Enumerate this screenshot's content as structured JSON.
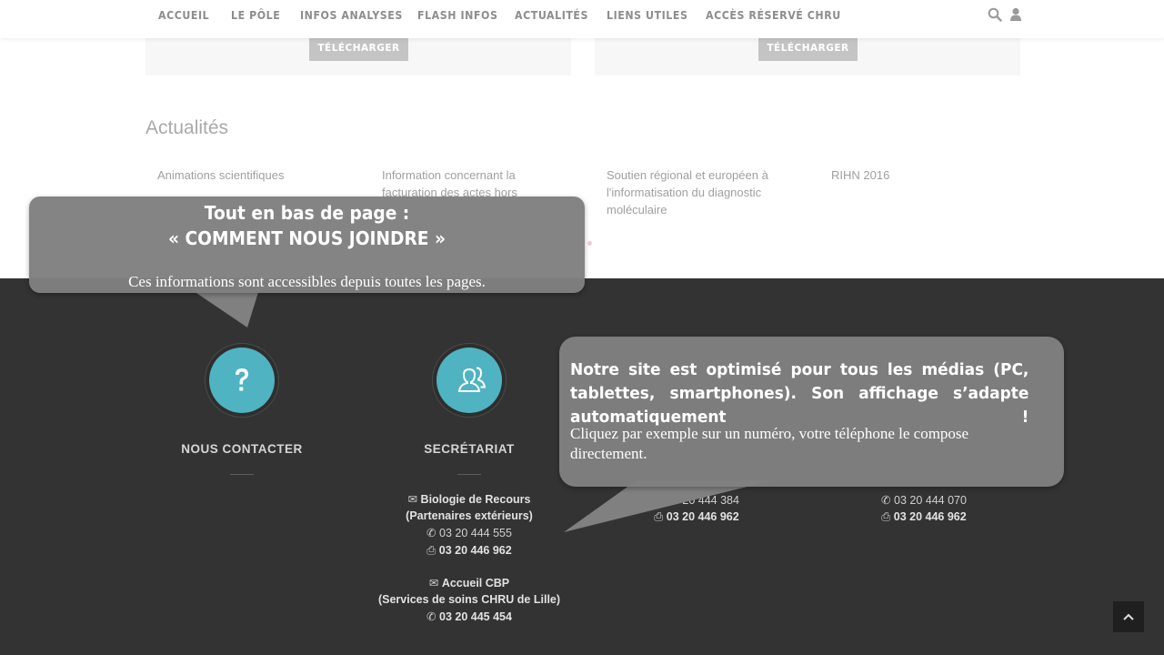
{
  "nav": {
    "items": [
      "ACCUEIL",
      "LE PÔLE",
      "INFOS ANALYSES",
      "FLASH INFOS",
      "ACTUALITÉS",
      "LIENS UTILES",
      "ACCÈS RÉSERVÉ CHRU"
    ],
    "icons": [
      "search-icon",
      "user-icon"
    ]
  },
  "downloads": {
    "button_label": "TÉLÉCHARGER"
  },
  "news": {
    "title": "Actualités",
    "items": [
      "Animations scientifiques",
      "Information concernant la facturation des actes hors",
      "Soutien régional et européen à l'informatisation du diagnostic moléculaire",
      "RIHN 2016"
    ]
  },
  "footer": {
    "contact_title": "NOUS CONTACTER",
    "secretariat_title": "SECRÉTARIAT",
    "secretariat": {
      "recours_name": "Biologie de Recours",
      "recours_sub": "(Partenaires extérieurs)",
      "recours_phone": "03 20 444 555",
      "recours_fax": "03 20 446 962",
      "cbp_name": "Accueil CBP",
      "cbp_sub": "(Services de soins CHRU de Lille)",
      "cbp_phone": "03 20 445 454"
    },
    "col3": {
      "phone": "03 20 444 384",
      "fax": "03 20 446 962"
    },
    "col4": {
      "phone": "03 20 444 070",
      "fax": "03 20 446 962"
    }
  },
  "callout1": {
    "line1": "Tout en bas de page :",
    "line2": "« COMMENT NOUS JOINDRE »",
    "body": "Ces informations sont accessibles depuis toutes les pages."
  },
  "callout2": {
    "headline": "Notre site est optimisé pour tous les médias (PC, tablettes, smartphones).  Son affichage s’adapte automatiquement  !",
    "body": "Cliquez par exemple sur un numéro, votre téléphone le compose directement."
  },
  "colors": {
    "accent": "#4fb3c2",
    "footer_bg": "#333333",
    "callout_bg": "#808080"
  }
}
